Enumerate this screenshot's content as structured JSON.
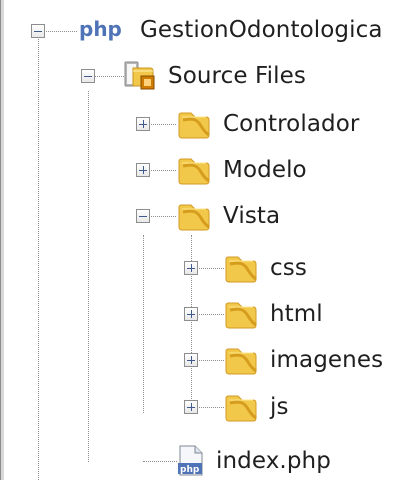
{
  "tree": {
    "project": {
      "label": "GestionOdontologica",
      "icon": "php-project-icon"
    },
    "source_files": {
      "label": "Source Files",
      "icon": "source-folder-icon"
    },
    "folders": {
      "controlador": "Controlador",
      "modelo": "Modelo",
      "vista": "Vista",
      "css": "css",
      "html": "html",
      "imagenes": "imagenes",
      "js": "js"
    },
    "file": {
      "label": "index.php",
      "icon": "php-file-icon"
    }
  },
  "colors": {
    "folder_fill": "#f2c84b",
    "folder_shadow": "#d59c1d",
    "php_blue": "#4f73b7",
    "tree_line": "#8f8f8f",
    "toggle_blue": "#405a8e"
  }
}
